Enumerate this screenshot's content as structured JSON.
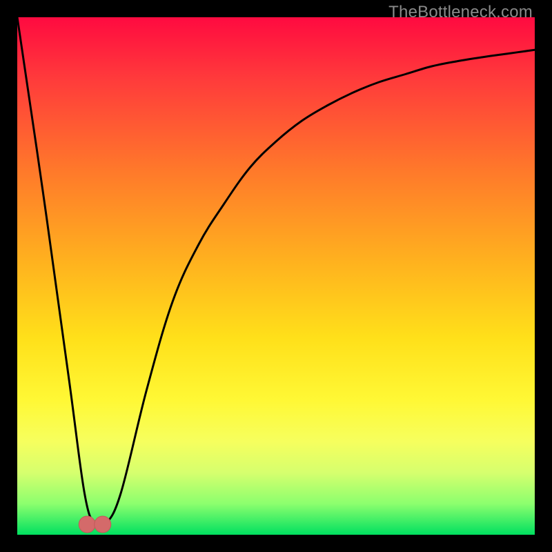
{
  "watermark": "TheBottleneck.com",
  "colors": {
    "background": "#000000",
    "curve": "#000000",
    "marker": "#d46a6a"
  },
  "chart_data": {
    "type": "line",
    "title": "",
    "xlabel": "",
    "ylabel": "",
    "xlim": [
      0,
      100
    ],
    "ylim": [
      0,
      100
    ],
    "grid": false,
    "legend": false,
    "series": [
      {
        "name": "bottleneck-curve",
        "x": [
          0,
          5,
          10,
          13,
          15,
          17,
          20,
          25,
          30,
          35,
          40,
          45,
          50,
          55,
          60,
          65,
          70,
          75,
          80,
          85,
          90,
          95,
          100
        ],
        "values": [
          100,
          66,
          30,
          8,
          2,
          2,
          8,
          28,
          45,
          56,
          64,
          71,
          76,
          80,
          83,
          85.5,
          87.5,
          89,
          90.5,
          91.5,
          92.3,
          93,
          93.7
        ]
      }
    ],
    "markers": {
      "x": [
        13.5,
        16.5
      ],
      "y": [
        2,
        2
      ],
      "radius_pct": 1.6
    },
    "bar_between_markers": {
      "x0": 13.5,
      "x1": 16.5,
      "height_pct": 1.2
    }
  }
}
